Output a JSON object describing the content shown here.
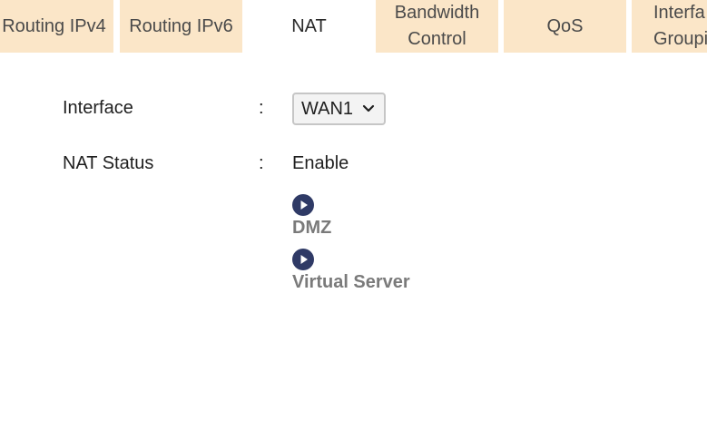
{
  "tabs": [
    {
      "label": "Routing IPv4"
    },
    {
      "label": "Routing IPv6"
    },
    {
      "label": "NAT",
      "active": true
    },
    {
      "label_line1": "Bandwidth",
      "label_line2": "Control"
    },
    {
      "label": "QoS"
    },
    {
      "label_line1": "Interfa",
      "label_line2": "Groupi"
    }
  ],
  "form": {
    "interface_label": "Interface",
    "nat_status_label": "NAT Status",
    "colon": ":",
    "interface_value": "WAN1",
    "nat_status_value": "Enable"
  },
  "links": {
    "dmz": "DMZ",
    "virtual_server": "Virtual Server"
  },
  "colors": {
    "tab_bg": "#fbe6c8",
    "active_tab_bg": "#ffffff",
    "arrow_icon": "#2f3a66",
    "link_text": "#7a7a7a"
  },
  "icons": {
    "select_chevron": "chevron-down-icon",
    "link_arrow": "arrow-circle-right-icon"
  }
}
